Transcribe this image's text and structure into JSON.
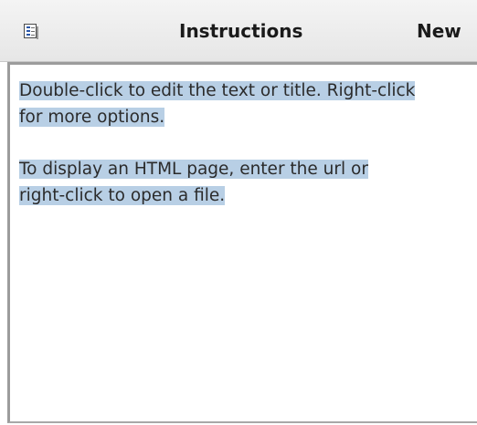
{
  "header": {
    "title": "Instructions",
    "new_label": "New"
  },
  "content": {
    "paragraphs": [
      {
        "lines": [
          "Double-click to edit the text or title. Right-click",
          "for more options."
        ]
      },
      {
        "lines": [
          "To display an HTML page, enter the url or",
          "right-click to open a file."
        ]
      }
    ]
  },
  "colors": {
    "selection": "#b8cfe5",
    "header_bg": "#ececec",
    "border": "#9c9c9c",
    "text": "#2b2b2b"
  },
  "icons": {
    "header_icon": "document-icon"
  }
}
